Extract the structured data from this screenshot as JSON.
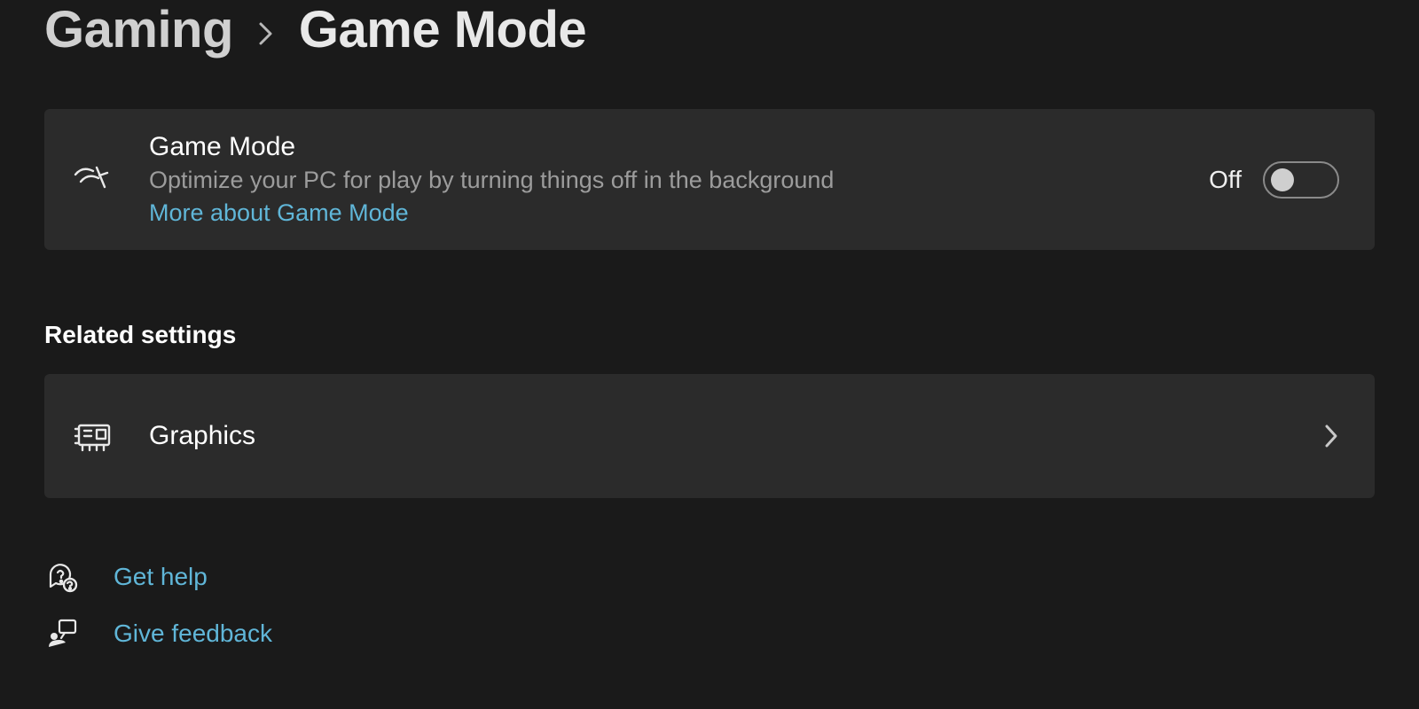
{
  "breadcrumb": {
    "parent": "Gaming",
    "current": "Game Mode"
  },
  "game_mode_card": {
    "title": "Game Mode",
    "description": "Optimize your PC for play by turning things off in the background",
    "link": "More about Game Mode",
    "toggle_state": "Off"
  },
  "related_section": {
    "heading": "Related settings",
    "items": [
      {
        "label": "Graphics"
      }
    ]
  },
  "footer": {
    "help": "Get help",
    "feedback": "Give feedback"
  }
}
